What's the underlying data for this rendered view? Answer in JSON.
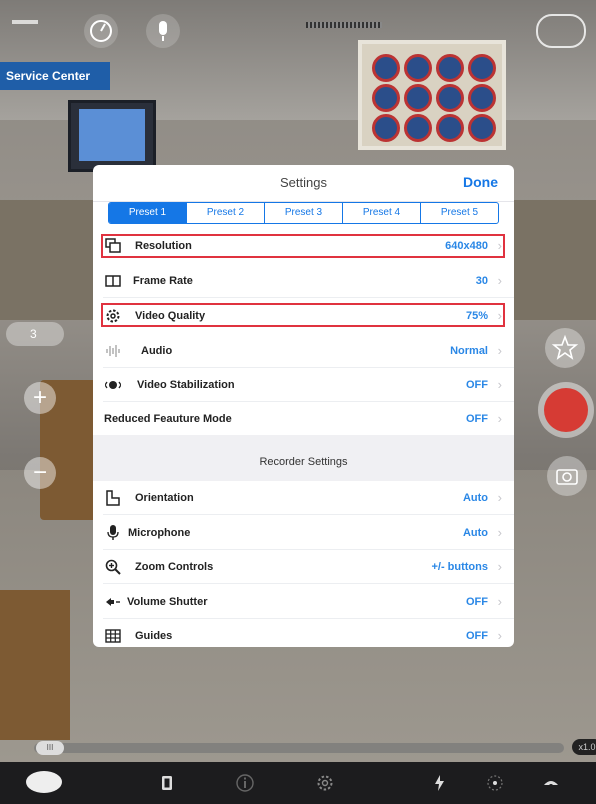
{
  "background": {
    "sign_text": "Service Center"
  },
  "camera": {
    "zoom_badge": "3",
    "zoom_in": "+",
    "zoom_out": "−",
    "zoom_level": "x1.0",
    "progress_label": "III"
  },
  "settings": {
    "title": "Settings",
    "done_label": "Done",
    "presets": [
      "Preset 1",
      "Preset 2",
      "Preset 3",
      "Preset 4",
      "Preset 5"
    ],
    "active_preset": "Preset 1",
    "rows": [
      {
        "label": "Resolution",
        "value": "640x480",
        "icon": "resolution-icon"
      },
      {
        "label": "Frame Rate",
        "value": "30",
        "icon": "frame-rate-icon"
      },
      {
        "label": "Video Quality",
        "value": "75%",
        "icon": "gear-icon"
      },
      {
        "label": "Audio",
        "value": "Normal",
        "icon": "audio-wave-icon"
      },
      {
        "label": "Video Stabilization",
        "value": "OFF",
        "icon": "stabilization-icon"
      },
      {
        "label": "Reduced Feauture Mode",
        "value": "OFF",
        "icon": ""
      }
    ],
    "recorder_section": "Recorder Settings",
    "recorder_rows": [
      {
        "label": "Orientation",
        "value": "Auto",
        "icon": "orientation-icon"
      },
      {
        "label": "Microphone",
        "value": "Auto",
        "icon": "microphone-icon"
      },
      {
        "label": "Zoom Controls",
        "value": "+/- buttons",
        "icon": "zoom-icon"
      },
      {
        "label": "Volume Shutter",
        "value": "OFF",
        "icon": "volume-icon"
      },
      {
        "label": "Guides",
        "value": "OFF",
        "icon": "grid-icon"
      }
    ]
  },
  "colors": {
    "accent": "#1577e6",
    "highlight": "#e0323f",
    "record": "#d63b34"
  }
}
